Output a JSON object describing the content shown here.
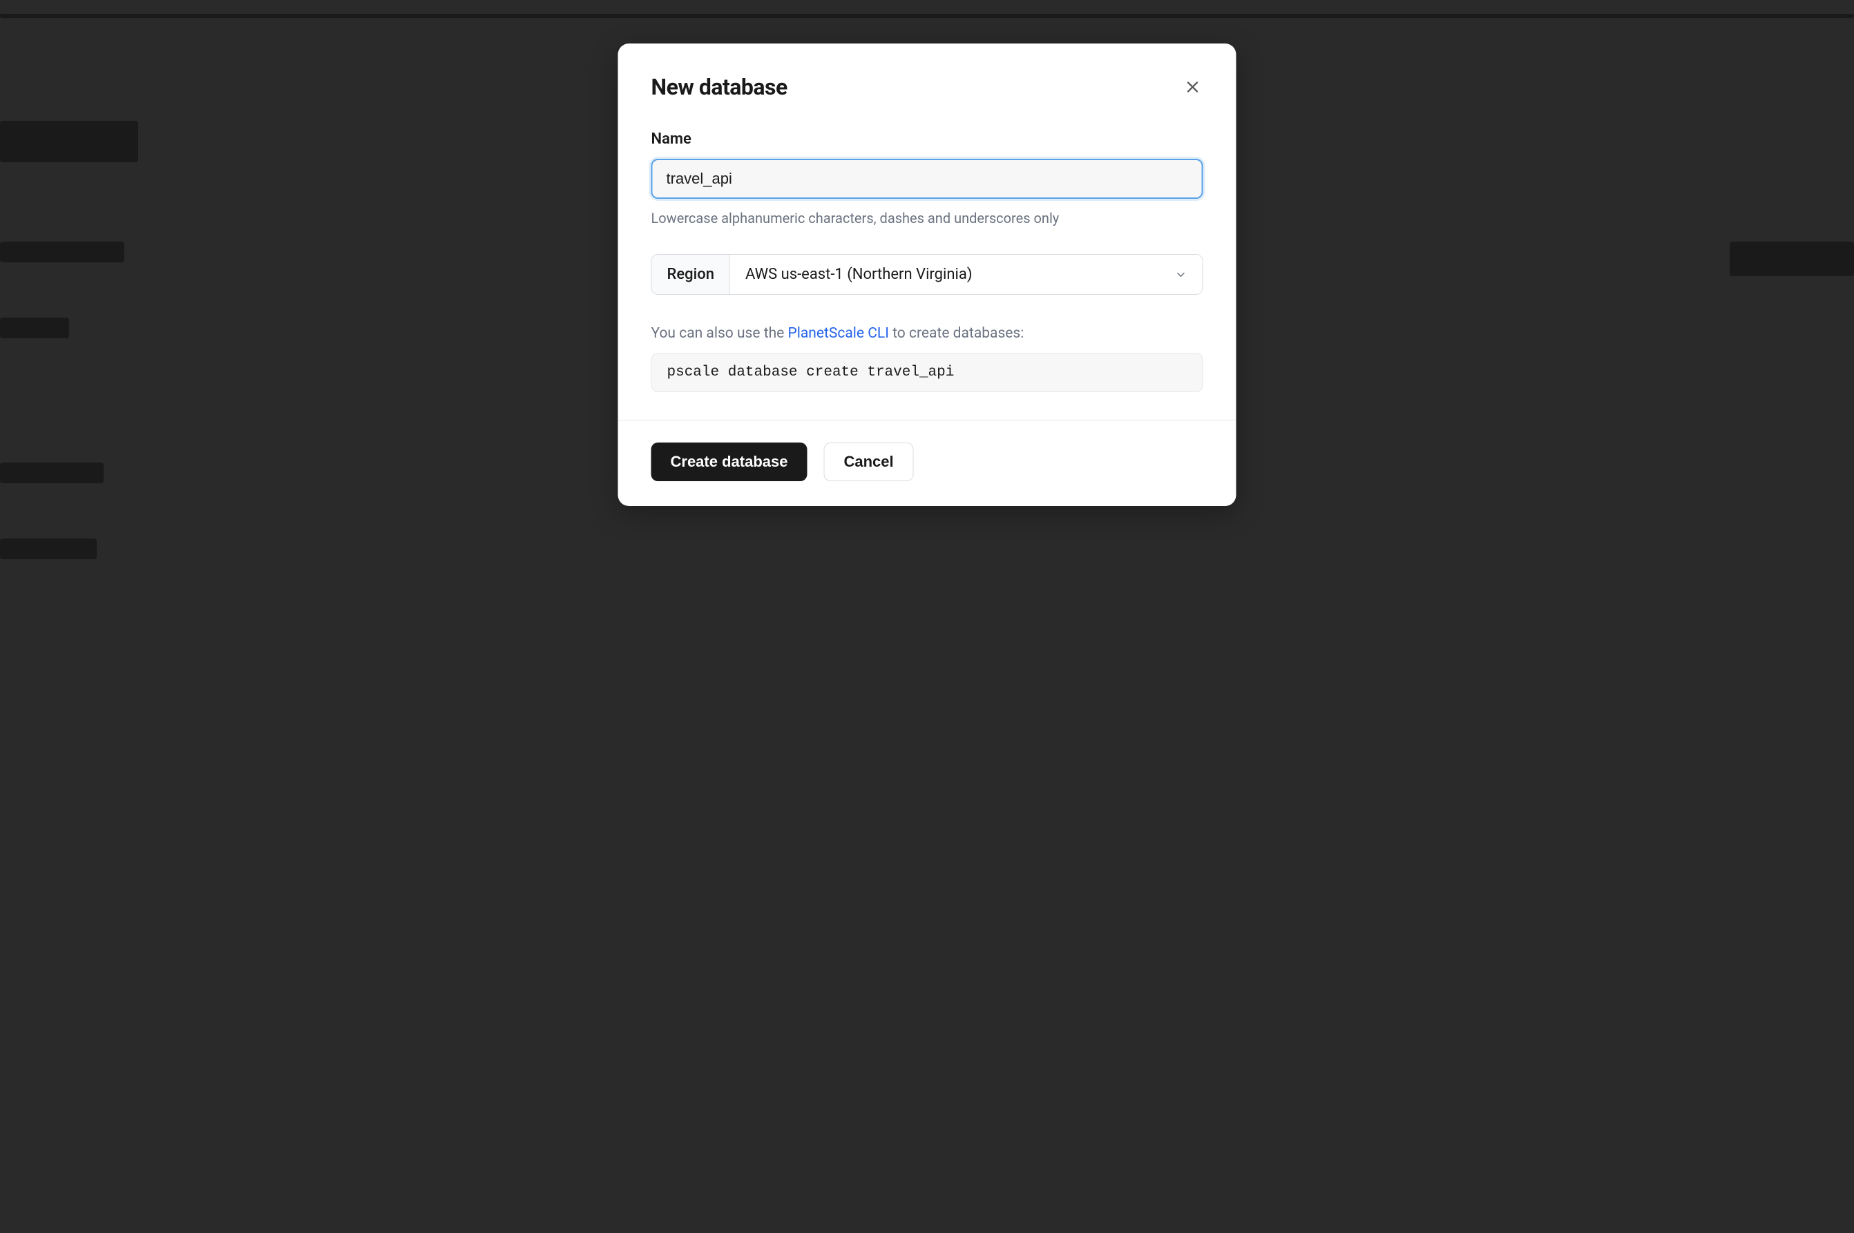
{
  "modal": {
    "title": "New database",
    "name_field": {
      "label": "Name",
      "value": "travel_api",
      "help": "Lowercase alphanumeric characters, dashes and underscores only"
    },
    "region": {
      "label": "Region",
      "selected": "AWS us-east-1 (Northern Virginia)"
    },
    "cli": {
      "prefix": "You can also use the ",
      "link_text": "PlanetScale CLI",
      "suffix": " to create databases:",
      "command": "pscale database create travel_api"
    },
    "buttons": {
      "primary": "Create database",
      "secondary": "Cancel"
    }
  }
}
